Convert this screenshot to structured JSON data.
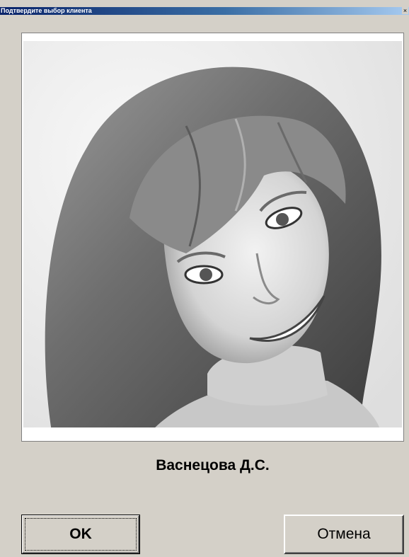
{
  "window": {
    "title": "Подтвердите выбор клиента",
    "close_glyph": "×"
  },
  "client": {
    "name": "Васнецова Д.С."
  },
  "buttons": {
    "ok_label": "OK",
    "cancel_label": "Отмена"
  },
  "colors": {
    "dialog_bg": "#d4d0c8",
    "title_gradient_start": "#0a246a",
    "title_gradient_end": "#a6caf0"
  }
}
